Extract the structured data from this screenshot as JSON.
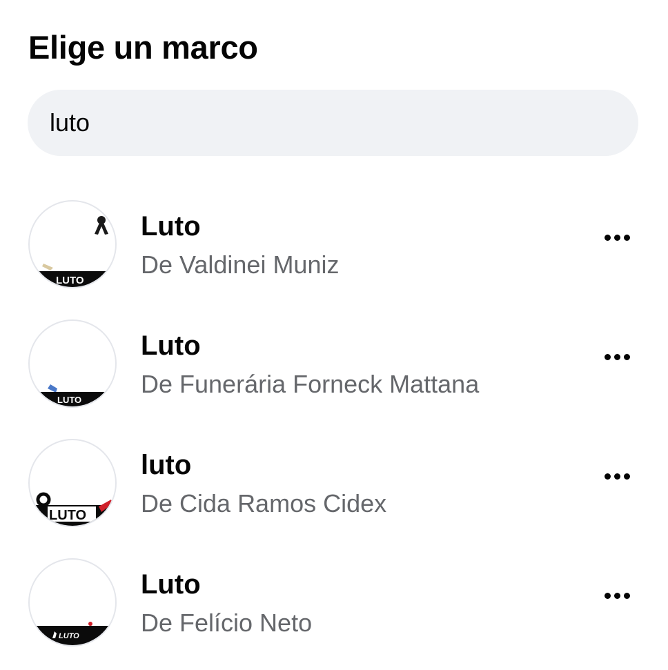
{
  "header": {
    "title": "Elige un marco"
  },
  "search": {
    "value": "luto"
  },
  "frames": [
    {
      "title": "Luto",
      "author": "De Valdinei Muniz",
      "banner_text": "LUTO",
      "style": "ribbon-top"
    },
    {
      "title": "Luto",
      "author": "De Funerária Forneck Mattana",
      "banner_text": "LUTO",
      "style": "blue-ribbon"
    },
    {
      "title": "luto",
      "author": "De Cida Ramos Cidex",
      "banner_text": "LUTO",
      "style": "red-ribbon"
    },
    {
      "title": "Luto",
      "author": "De Felício Neto",
      "banner_text": "LUTO",
      "style": "small-ribbon"
    }
  ],
  "colors": {
    "title_text": "#050505",
    "secondary_text": "#65676b",
    "search_bg": "#f0f2f5",
    "banner_black": "#0b0b0b",
    "ribbon_red": "#d0202a",
    "ribbon_blue": "#4a78c8"
  },
  "icons": {
    "more": "more-horizontal-icon",
    "ribbon": "mourning-ribbon-icon"
  }
}
